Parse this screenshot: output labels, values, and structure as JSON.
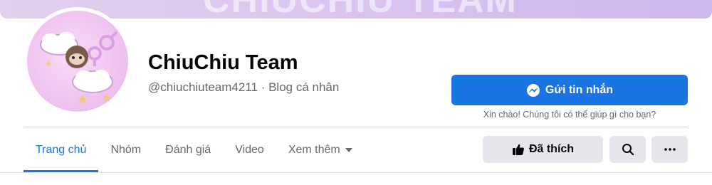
{
  "cover": {
    "text": "CHIUCHIU TEAM"
  },
  "profile": {
    "name": "ChiuChiu Team",
    "handle": "@chiuchiuteam4211 · Blog cá nhân"
  },
  "actions": {
    "message_label": "Gửi tin nhắn",
    "greeting": "Xin chào! Chúng tôi có thể giúp gì cho bạn?",
    "liked_label": "Đã thích"
  },
  "tabs": [
    {
      "label": "Trang chủ",
      "active": true
    },
    {
      "label": "Nhóm",
      "active": false
    },
    {
      "label": "Đánh giá",
      "active": false
    },
    {
      "label": "Video",
      "active": false
    },
    {
      "label": "Xem thêm",
      "active": false
    }
  ],
  "colors": {
    "accent": "#1b74e4",
    "button_gray": "#e4e6eb",
    "secondary_text": "#65676b"
  },
  "icons": {
    "message": "messenger-icon",
    "like": "thumbs-up-icon",
    "search": "search-icon",
    "more": "more-horizontal-icon",
    "dropdown": "caret-down-icon"
  }
}
